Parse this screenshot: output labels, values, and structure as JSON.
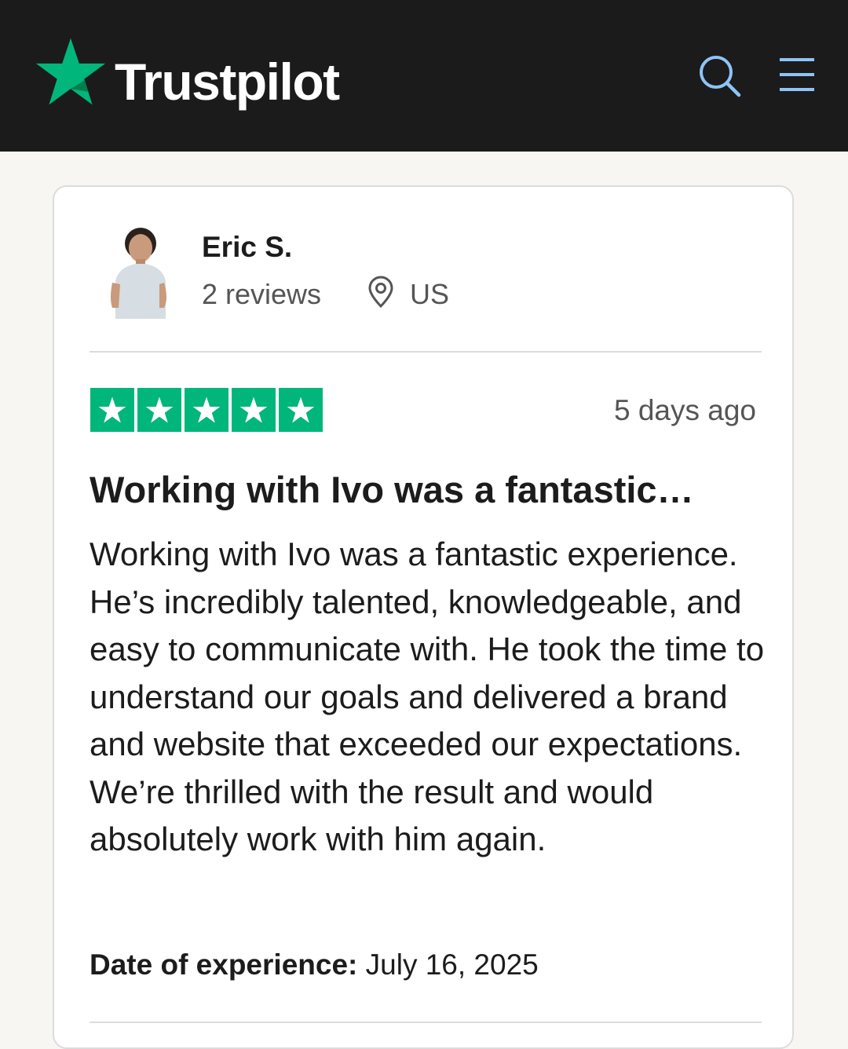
{
  "header": {
    "brand": "Trustpilot",
    "brand_color": "#00b67a",
    "icons": [
      "search-icon",
      "menu-icon"
    ]
  },
  "review": {
    "reviewer": {
      "name": "Eric S.",
      "reviews": "2 reviews",
      "country": "US",
      "icon": "location-pin-icon"
    },
    "rating": 5,
    "rating_max": 5,
    "posted": "5 days ago",
    "title": "Working with Ivo was a fantastic…",
    "body": "Working with Ivo was a fantastic experience. He’s incredibly talented, knowledgeable, and easy to communicate with. He took the time to understand our goals and delivered a brand and website that exceeded our expectations. We’re thrilled with the result and would absolutely work with him again.",
    "experience_label": "Date of experience:",
    "experience_date": "July 16, 2025"
  }
}
